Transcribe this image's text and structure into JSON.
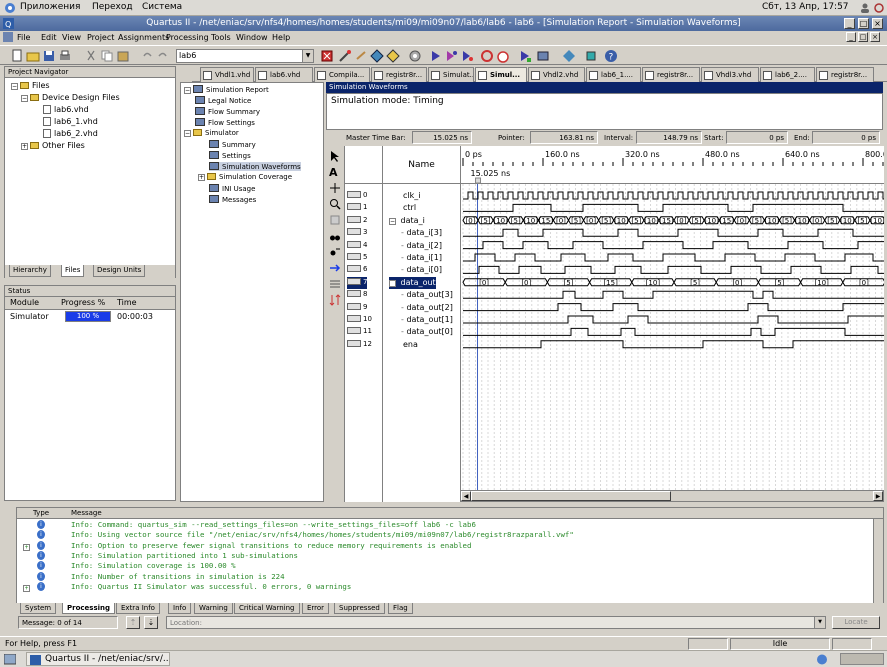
{
  "system_bar": {
    "menu": [
      "Приложения",
      "Переход",
      "Система"
    ],
    "clock": "Сбт, 13 Апр, 17:57"
  },
  "window": {
    "title": "Quartus II - /net/eniac/srv/nfs4/homes/homes/students/mi09/mi09n07/lab6/lab6 - lab6 - [Simulation Report - Simulation Waveforms]"
  },
  "menubar": [
    "File",
    "Edit",
    "View",
    "Project",
    "Assignments",
    "Processing",
    "Tools",
    "Window",
    "Help"
  ],
  "toolbar": {
    "project_select": "lab6"
  },
  "doc_tabs": [
    "Vhdl1.vhd",
    "lab6.vhd",
    "Compila...",
    "registr8r...",
    "Simulat...",
    "Simul...",
    "Vhdl2.vhd",
    "lab6_1....",
    "registr8r...",
    "Vhdl3.vhd",
    "lab6_2....",
    "registr8r..."
  ],
  "project_navigator": {
    "title": "Project Navigator",
    "root": "Files",
    "folder": "Device Design Files",
    "files": [
      "lab6.vhd",
      "lab6_1.vhd",
      "lab6_2.vhd"
    ],
    "other": "Other Files",
    "tabs": [
      "Hierarchy",
      "Files",
      "Design Units"
    ]
  },
  "status_panel": {
    "title": "Status",
    "col_module": "Module",
    "col_progress": "Progress %",
    "col_time": "Time",
    "module": "Simulator",
    "progress": "100 %",
    "progress_value": 100,
    "time": "00:00:03"
  },
  "report_tree": {
    "root": "Simulation Report",
    "items": [
      "Legal Notice",
      "Flow Summary",
      "Flow Settings"
    ],
    "simulator": "Simulator",
    "sim_items": [
      "Summary",
      "Settings",
      "Simulation Waveforms",
      "Simulation Coverage",
      "INI Usage",
      "Messages"
    ]
  },
  "sim": {
    "header": "Simulation Waveforms",
    "mode": "Simulation mode: Timing",
    "master_time_bar_label": "Master Time Bar:",
    "master_time_bar": "15.025 ns",
    "pointer_label": "Pointer:",
    "pointer": "163.81 ns",
    "interval_label": "Interval:",
    "interval": "148.79 ns",
    "start_label": "Start:",
    "start": "0 ps",
    "end_label": "End:",
    "end": "0 ps",
    "name_header": "Name",
    "time_ticks": [
      "0 ps",
      "160.0 ns",
      "320.0 ns",
      "480.0 ns",
      "640.0 ns",
      "800.0 ns"
    ],
    "cursor_label": "15.025 ns"
  },
  "signals": [
    {
      "id": "0",
      "name": "clk_i"
    },
    {
      "id": "1",
      "name": "ctrl"
    },
    {
      "id": "2",
      "name": "data_i"
    },
    {
      "id": "3",
      "name": "data_i[3]"
    },
    {
      "id": "4",
      "name": "data_i[2]"
    },
    {
      "id": "5",
      "name": "data_i[1]"
    },
    {
      "id": "6",
      "name": "data_i[0]"
    },
    {
      "id": "7",
      "name": "data_out"
    },
    {
      "id": "8",
      "name": "data_out[3]"
    },
    {
      "id": "9",
      "name": "data_out[2]"
    },
    {
      "id": "10",
      "name": "data_out[1]"
    },
    {
      "id": "11",
      "name": "data_out[0]"
    },
    {
      "id": "12",
      "name": "ena"
    }
  ],
  "bus_labels": {
    "data_i": [
      "[0]",
      "[5]",
      "[10]",
      "[5]",
      "[10]",
      "[15]",
      "[0]",
      "[5]",
      "[0]",
      "[5]",
      "[10]",
      "[5]",
      "[10]",
      "[15]",
      "[0]",
      "[5]",
      "[10]",
      "[15]",
      "[0]",
      "[5]",
      "[10]",
      "[5]",
      "[10]",
      "[0]",
      "[5]",
      "[10]",
      "[5]",
      "[10]"
    ],
    "data_out": [
      "[0]",
      "[0]",
      "[5]",
      "[15]",
      "[10]",
      "[5]",
      "[0]",
      "[5]",
      "[10]",
      "[0]"
    ]
  },
  "messages": {
    "col_type": "Type",
    "col_message": "Message",
    "rows": [
      {
        "exp": "",
        "text": "Info: Command: quartus_sim --read_settings_files=on --write_settings_files=off lab6 -c lab6"
      },
      {
        "exp": "",
        "text": "Info: Using vector source file \"/net/eniac/srv/nfs4/homes/homes/students/mi09/mi09n07/lab6/registr8razparall.vwf\""
      },
      {
        "exp": "+",
        "text": "Info: Option to preserve fewer signal transitions to reduce memory requirements is enabled"
      },
      {
        "exp": "",
        "text": "Info: Simulation partitioned into 1 sub-simulations"
      },
      {
        "exp": "",
        "text": "Info: Simulation coverage is      100.00 %"
      },
      {
        "exp": "",
        "text": "Info: Number of transitions in simulation is 224"
      },
      {
        "exp": "+",
        "text": "Info: Quartus II Simulator was successful. 0 errors, 0 warnings"
      }
    ],
    "tabs": [
      "System",
      "Processing",
      "Extra Info",
      "Info",
      "Warning",
      "Critical Warning",
      "Error",
      "Suppressed",
      "Flag"
    ],
    "count": "Message: 0 of 14",
    "location_placeholder": "Location:",
    "locate_button": "Locate"
  },
  "statusbar": {
    "help": "For Help, press F1",
    "state": "Idle"
  },
  "taskbar": {
    "app": "Quartus II - /net/eniac/srv/..."
  }
}
